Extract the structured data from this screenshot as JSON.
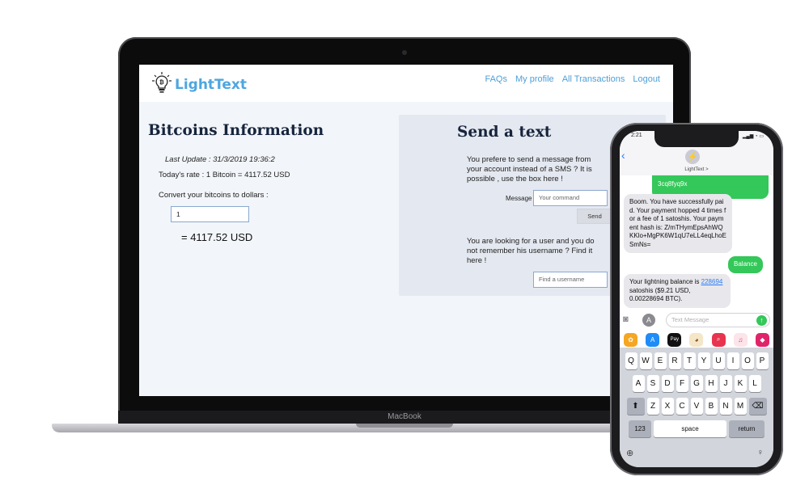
{
  "laptop": {
    "brand": "MacBook",
    "app": {
      "logo_text": "LightText",
      "nav": [
        "FAQs",
        "My profile",
        "All Transactions",
        "Logout"
      ],
      "left": {
        "title": "Bitcoins Information",
        "last_update": "Last Update : 31/3/2019 19:36:2",
        "rate": "Today's rate : 1 Bitcoin = 4117.52 USD",
        "convert_label": "Convert your bitcoins to dollars :",
        "amount_value": "1",
        "result": "= 4117.52 USD"
      },
      "right": {
        "title": "Send a text",
        "text1": "You prefere to send a message from your account instead of a SMS ? It is possible , use the box here !",
        "message_label": "Message",
        "message_placeholder": "Your command",
        "send_label": "Send",
        "text2": "You are looking for a user and you do not remember his username ? Find it here !",
        "find_placeholder": "Find a username"
      }
    }
  },
  "phone": {
    "time": "2:21",
    "contact_name": "LightText >",
    "messages": [
      {
        "dir": "out",
        "text": "3cq8fyq9x"
      },
      {
        "dir": "in",
        "text": "Boom. You have successfully paid. Your payment hopped 4 times for a fee of 1 satoshis. Your payment hash is: Z/mTHymEpsAhWQKKlo+MgPK6W1qU7eLL4eqLhoESmNs="
      },
      {
        "dir": "out",
        "text": "Balance"
      },
      {
        "dir": "in",
        "prefix": "Your lightning balance is ",
        "link": "228694",
        "suffix": " satoshis ($9.21 USD, 0.00228694 BTC)."
      }
    ],
    "input_placeholder": "Text Message",
    "keyboard": {
      "row1": [
        "Q",
        "W",
        "E",
        "R",
        "T",
        "Y",
        "U",
        "I",
        "O",
        "P"
      ],
      "row2": [
        "A",
        "S",
        "D",
        "F",
        "G",
        "H",
        "J",
        "K",
        "L"
      ],
      "row3": [
        "Z",
        "X",
        "C",
        "V",
        "B",
        "N",
        "M"
      ],
      "num_label": "123",
      "space_label": "space",
      "return_label": "return"
    }
  }
}
